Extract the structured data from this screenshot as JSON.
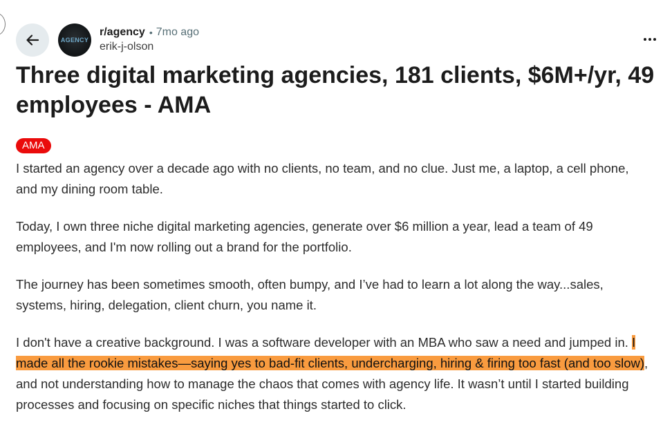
{
  "post": {
    "subreddit": "r/agency",
    "separator": "•",
    "time_ago": "7mo ago",
    "author": "erik-j-olson",
    "avatar_text": "AGENCY",
    "title": "Three digital marketing agencies, 181 clients, $6M+/yr, 49 employees - AMA",
    "flair": "AMA",
    "paragraphs": [
      "I started an agency over a decade ago with no clients, no team, and no clue. Just me, a laptop, a cell phone, and my dining room table.",
      "Today, I own three niche digital marketing agencies, generate over $6 million a year, lead a team of 49 employees, and I'm now rolling out a brand for the portfolio.",
      "The journey has been sometimes smooth, often bumpy, and I’ve had to learn a lot along the way...sales, systems, hiring, delegation, client churn, you name it."
    ],
    "paragraph4": {
      "before": "I don't have a creative background. I was a software developer with an MBA who saw a need and jumped in. ",
      "highlight": "I made all the rookie mistakes—saying yes to bad-fit clients, undercharging, hiring & firing too fast (and too slow)",
      "after": ", and not understanding how to manage the chaos that comes with agency life. It wasn’t until I started building processes and focusing on specific niches that things started to click."
    }
  },
  "icons": {
    "back": "arrow-left-icon",
    "more": "more-horizontal-icon"
  },
  "colors": {
    "flair_bg": "#ea0b0b",
    "highlight": "#f99b3f",
    "back_button_bg": "#e5ebee",
    "meta_gray": "#576f76"
  }
}
